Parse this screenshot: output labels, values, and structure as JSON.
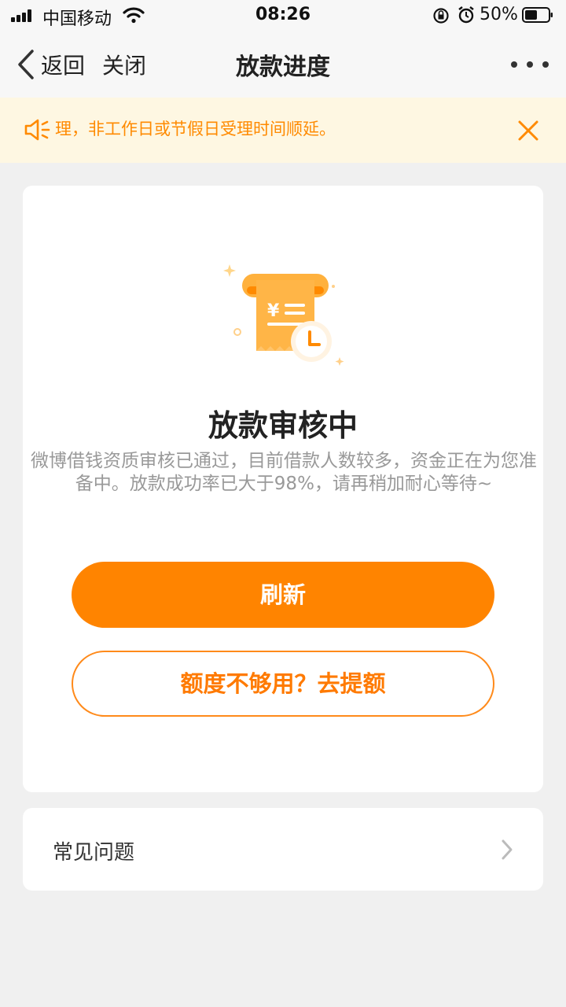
{
  "status_bar": {
    "carrier": "中国移动",
    "time": "08:26",
    "battery": "50%",
    "icons": [
      "signal-icon",
      "wifi-icon",
      "orientation-lock-icon",
      "alarm-icon",
      "battery-icon"
    ]
  },
  "nav": {
    "back_label": "返回",
    "close_label": "关闭",
    "title": "放款进度",
    "more_icon": "more-icon"
  },
  "notice": {
    "text": "理，非工作日或节假日受理时间顺延。",
    "icon": "speaker-icon",
    "close_icon": "close-icon"
  },
  "status": {
    "illustration_icon": "receipt-clock-icon",
    "title": "放款审核中",
    "description": "微博借钱资质审核已通过，目前借款人数较多，资金正在为您准备中。放款成功率已大于98%，请再稍加耐心等待~"
  },
  "actions": {
    "refresh_label": "刷新",
    "raise_limit_label": "额度不够用？去提额"
  },
  "faq": {
    "label": "常见问题",
    "chevron_icon": "chevron-right-icon"
  },
  "colors": {
    "accent": "#ff8400",
    "notice_bg": "#fef7e2",
    "notice_text": "#ff8a00",
    "page_bg": "#f0f0f0"
  }
}
